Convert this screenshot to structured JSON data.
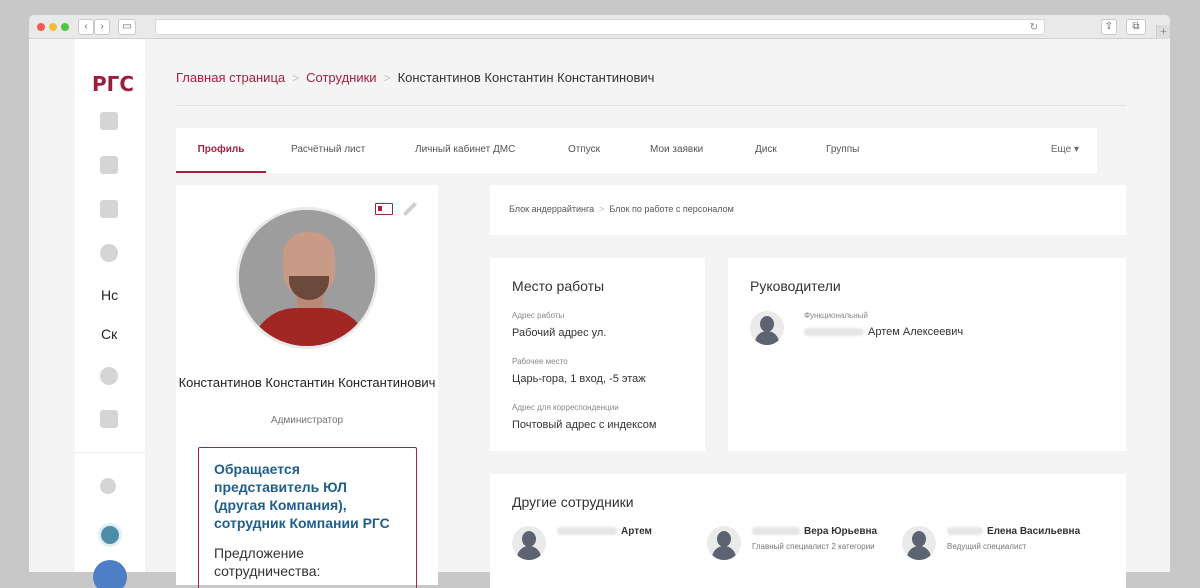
{
  "sidebar": {
    "logo": "РГС",
    "items": [
      {
        "icon": "dashboard-icon"
      },
      {
        "icon": "news-icon"
      },
      {
        "icon": "contact-card-icon"
      },
      {
        "icon": "parking-icon"
      },
      {
        "label": "Нс"
      },
      {
        "label": "Ск"
      },
      {
        "icon": "info-icon"
      },
      {
        "icon": "book-icon"
      },
      {
        "icon": "settings-icon"
      }
    ]
  },
  "breadcrumb": {
    "home": "Главная страница",
    "employees": "Сотрудники",
    "current": "Константинов Константин Константинович",
    "separator": ">"
  },
  "tabs": {
    "items": [
      "Профиль",
      "Расчётный лист",
      "Личный кабинет ДМС",
      "Отпуск",
      "Мои заявки",
      "Диск",
      "Группы"
    ],
    "more": "Еще ▾",
    "active_index": 0
  },
  "profile": {
    "name": "Константинов Константин Константинович",
    "role": "Администратор",
    "notice_title": "Обращается представитель ЮЛ (другая Компания), сотрудник Компании РГС",
    "notice_text": "Предложение сотрудничества:"
  },
  "department": {
    "parent": "Блок андеррайтинга",
    "child": "Блок по работе с персоналом"
  },
  "workplace": {
    "title": "Место работы",
    "fields": [
      {
        "label": "Адрес работы",
        "value": "Рабочий адрес ул."
      },
      {
        "label": "Рабочее место",
        "value": "Царь-гора, 1 вход, -5 этаж"
      },
      {
        "label": "Адрес для корреспонденции",
        "value": "Почтовый адрес с индексом"
      }
    ]
  },
  "managers": {
    "title": "Руководители",
    "items": [
      {
        "label": "Функциональный",
        "name": "Артем Алексеевич"
      }
    ]
  },
  "others": {
    "title": "Другие сотрудники",
    "items": [
      {
        "name": "Артем",
        "position": ""
      },
      {
        "name": "Вера Юрьевна",
        "position": "Главный специалист 2 категории"
      },
      {
        "name": "Елена Васильевна",
        "position": "Ведущий специалист"
      }
    ]
  },
  "colors": {
    "accent": "#a4213f",
    "link_blue": "#1f5f8b"
  }
}
